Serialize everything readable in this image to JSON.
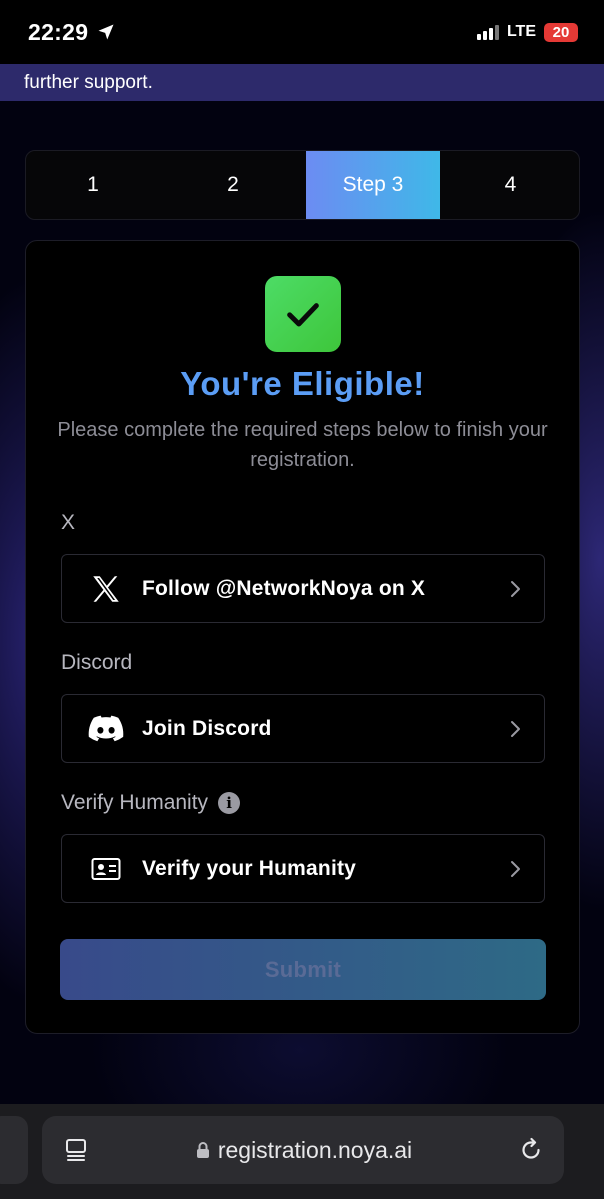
{
  "status_bar": {
    "time": "22:29",
    "network": "LTE",
    "battery": "20"
  },
  "banner": {
    "text": "further support."
  },
  "stepper": {
    "steps": [
      "1",
      "2",
      "Step 3",
      "4"
    ],
    "active_index": 2
  },
  "card": {
    "headline": "You're Eligible!",
    "subtext": "Please complete the required steps below to finish your registration.",
    "sections": [
      {
        "label": "X",
        "task": "Follow @NetworkNoya on X",
        "icon": "x-logo-icon"
      },
      {
        "label": "Discord",
        "task": "Join Discord",
        "icon": "discord-icon"
      },
      {
        "label": "Verify Humanity",
        "task": "Verify your Humanity",
        "icon": "id-card-icon"
      }
    ],
    "submit_label": "Submit"
  },
  "browser": {
    "url": "registration.noya.ai"
  },
  "colors": {
    "headline": "#5b9df5",
    "active_step_gradient_start": "#6c8cf2",
    "active_step_gradient_end": "#3fb8e8",
    "check_green": "#4ddc66",
    "battery_red": "#e53935",
    "banner_purple": "#2d2a6b"
  }
}
